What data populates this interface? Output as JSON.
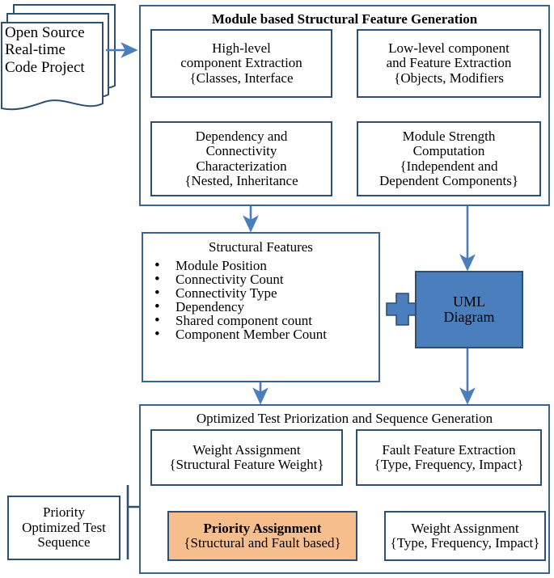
{
  "diagram": {
    "title_implicit": "Module based Structural Feature Generation pipeline",
    "accent_blue": "#4a7ebc",
    "border_blue": "#2e4f72",
    "orange_fill": "#f6be8d",
    "uml_fill": "#4a7ebc"
  },
  "source": {
    "line1": "Open    Source",
    "line2": "Real-time",
    "line3": "Code  Project"
  },
  "module_section": {
    "title": "Module based Structural Feature Generation",
    "high_level": {
      "line1": "High-level",
      "line2": "component  Extraction",
      "line3": "{Classes, Interface",
      "line4": "}"
    },
    "low_level": {
      "line1": "Low-level component",
      "line2": "and Feature Extraction",
      "line3": "{Objects, Modifiers",
      "line4": "}"
    },
    "dependency": {
      "line1": "Dependency and",
      "line2": "Connectivity",
      "line3": "Characterization",
      "line4": "{Nested, Inheritance",
      "line5": "}"
    },
    "module_strength": {
      "line1": "Module Strength",
      "line2": "Computation",
      "line3": "{Independent and",
      "line4": "Dependent Components}"
    }
  },
  "structural_features": {
    "title": "Structural Features",
    "items": [
      "Module Position",
      "Connectivity Count",
      "Connectivity Type",
      "Dependency",
      "Shared component count",
      "Component Member Count"
    ]
  },
  "uml": {
    "line1": "UML",
    "line2": "Diagram"
  },
  "plus_symbol": "+",
  "optimized_section": {
    "title": "Optimized Test Priorization and Sequence Generation",
    "weight_structural": {
      "line1": "Weight Assignment",
      "line2": "{Structural Feature Weight}"
    },
    "fault_feature": {
      "line1": "Fault Feature Extraction",
      "line2": "{Type, Frequency, Impact}"
    },
    "priority_assignment": {
      "line1": "Priority Assignment",
      "line2": "{Structural and Fault based}"
    },
    "weight_fault": {
      "line1": "Weight Assignment",
      "line2": "{Type, Frequency, Impact}"
    }
  },
  "output": {
    "line1": "Priority",
    "line2": "Optimized Test",
    "line3": "Sequence"
  }
}
